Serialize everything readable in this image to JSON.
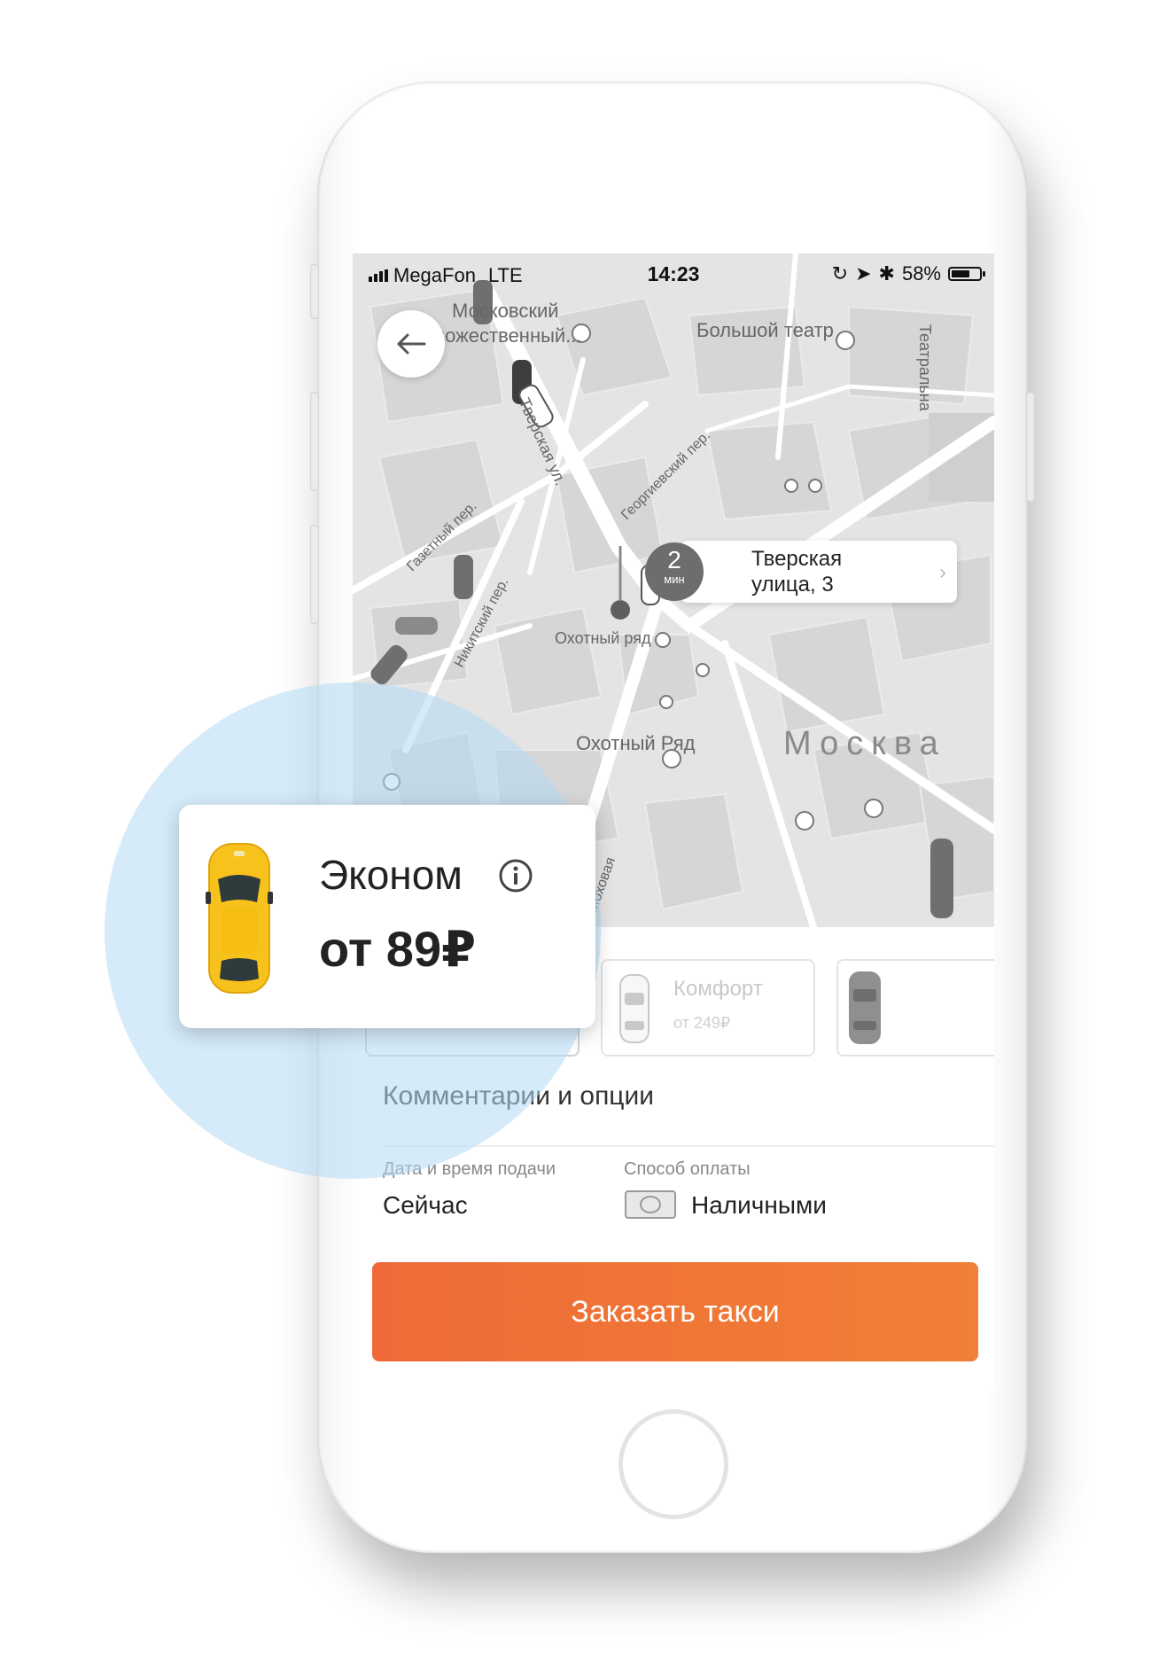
{
  "status_bar": {
    "carrier": "MegaFon",
    "network": "LTE",
    "time": "14:23",
    "battery": "58%",
    "icons": [
      "signal-icon",
      "lock-rotation-icon",
      "location-arrow-icon",
      "bluetooth-icon",
      "battery-icon"
    ]
  },
  "map": {
    "labels": {
      "moscow_art": "Московский",
      "moscow_art_2": "художественный...",
      "bolshoi": "Большой театр",
      "theatre_pass": "Театральна",
      "tverskaya_st": "Тверская ул.",
      "georgievsky": "Георгиевский пер.",
      "gazetny": "Газетный пер.",
      "nikitsky": "Никитский пер.",
      "okhotny_metro": "Охотный ряд",
      "okhotny_ryad": "Охотный Ряд",
      "moskva": "Москва",
      "mokhovaya": "Моховая"
    },
    "pickup": {
      "eta_value": "2",
      "eta_unit": "мин",
      "address_line1": "Тверская",
      "address_line2": "улица, 3"
    }
  },
  "tariffs": [
    {
      "name": "Эконом",
      "price": "от 89₽",
      "selected": true
    },
    {
      "name": "Комфорт",
      "price": "от 249₽",
      "selected": false
    }
  ],
  "options": {
    "comments_label": "Комментарии и опции",
    "datetime_label": "Дата и время подачи",
    "datetime_value": "Сейчас",
    "payment_label": "Способ оплаты",
    "payment_value": "Наличными"
  },
  "order_button": "Заказать такси",
  "zoom": {
    "name": "Эконом",
    "price": "от 89₽"
  },
  "colors": {
    "accent": "#EF6A38",
    "taxi_yellow": "#F8C21C",
    "magnifier": "#B2DAF5"
  }
}
